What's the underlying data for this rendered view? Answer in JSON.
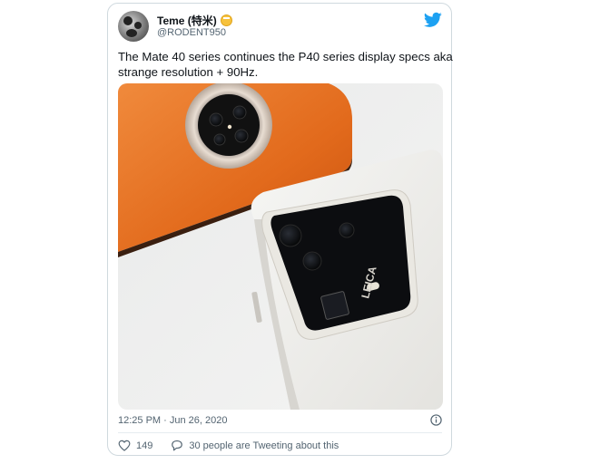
{
  "tweet": {
    "author_name": "Teme (特米)",
    "author_emoji": "emoji-grin-icon",
    "handle": "@RODENT950",
    "text_line1": "The Mate 40 series continues the P40 series display specs aka",
    "text_line2": "strange resolution + 90Hz.",
    "photo_brand_text": "LEICA",
    "timestamp": "12:25 PM · Jun 26, 2020",
    "like_count": "149",
    "reply_text": "30 people are Tweeting about this"
  },
  "icons": {
    "logo": "twitter-bird-icon",
    "info": "info-icon",
    "like": "heart-icon",
    "reply": "speech-bubble-icon"
  },
  "colors": {
    "brand": "#1da1f2",
    "secondary_text": "#536471",
    "border": "#cfd9de"
  }
}
